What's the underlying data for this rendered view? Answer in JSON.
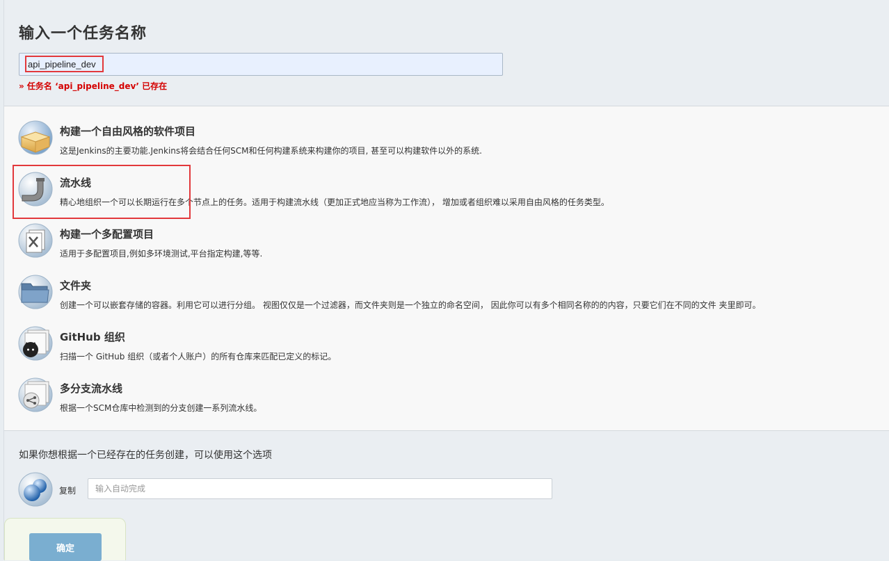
{
  "header": {
    "title": "输入一个任务名称",
    "name_value": "api_pipeline_dev",
    "error": "» 任务名 ‘api_pipeline_dev’ 已存在"
  },
  "items": [
    {
      "name": "构建一个自由风格的软件项目",
      "desc": "这是Jenkins的主要功能.Jenkins将会结合任何SCM和任何构建系统来构建你的项目, 甚至可以构建软件以外的系统.",
      "icon": "freestyle-box-icon"
    },
    {
      "name": "流水线",
      "desc": "精心地组织一个可以长期运行在多个节点上的任务。适用于构建流水线（更加正式地应当称为工作流）， 增加或者组织难以采用自由风格的任务类型。",
      "icon": "pipeline-icon"
    },
    {
      "name": "构建一个多配置项目",
      "desc": "适用于多配置项目,例如多环境测试,平台指定构建,等等.",
      "icon": "multi-config-icon"
    },
    {
      "name": "文件夹",
      "desc": "创建一个可以嵌套存储的容器。利用它可以进行分组。 视图仅仅是一个过滤器，而文件夹则是一个独立的命名空间， 因此你可以有多个相同名称的的内容，只要它们在不同的文件 夹里即可。",
      "icon": "folder-icon"
    },
    {
      "name": "GitHub 组织",
      "desc": "扫描一个 GitHub 组织（或者个人账户）的所有仓库来匹配已定义的标记。",
      "icon": "github-org-icon"
    },
    {
      "name": "多分支流水线",
      "desc": "根据一个SCM仓库中检测到的分支创建一系列流水线。",
      "icon": "multibranch-icon"
    }
  ],
  "copy": {
    "text": "如果你想根据一个已经存在的任务创建，可以使用这个选项",
    "label": "复制",
    "placeholder": "输入自动完成"
  },
  "footer": {
    "ok_label": "确定"
  },
  "colors": {
    "highlight": "#e2383b",
    "error": "#d40000",
    "ok_button": "#7aaed0"
  }
}
